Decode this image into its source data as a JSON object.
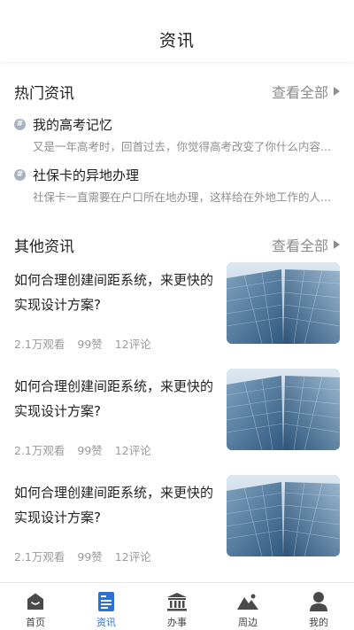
{
  "header": {
    "title": "资讯"
  },
  "hot": {
    "title": "热门资讯",
    "more_label": "查看全部",
    "items": [
      {
        "title": "我的高考记忆",
        "desc": "又是一年高考时，回首过去，你觉得高考改变了你什么内容..."
      },
      {
        "title": "社保卡的异地办理",
        "desc": "社保卡一直需要在户口所在地办理，这样给在外地工作的人..."
      }
    ]
  },
  "other": {
    "title": "其他资讯",
    "more_label": "查看全部",
    "items": [
      {
        "title": "如何合理创建间距系统，来更快的实现设计方案?",
        "views": "2.1万观看",
        "likes": "99赞",
        "comments": "12评论"
      },
      {
        "title": "如何合理创建间距系统，来更快的实现设计方案?",
        "views": "2.1万观看",
        "likes": "99赞",
        "comments": "12评论"
      },
      {
        "title": "如何合理创建间距系统，来更快的实现设计方案?",
        "views": "2.1万观看",
        "likes": "99赞",
        "comments": "12评论"
      }
    ]
  },
  "tabbar": {
    "active_color": "#2f6fd6",
    "icon_color": "#4a4a4a",
    "tabs": [
      {
        "label": "首页",
        "icon": "home-icon"
      },
      {
        "label": "资讯",
        "icon": "news-icon",
        "active": true
      },
      {
        "label": "办事",
        "icon": "building-icon"
      },
      {
        "label": "周边",
        "icon": "mountain-icon"
      },
      {
        "label": "我的",
        "icon": "user-icon"
      }
    ]
  }
}
